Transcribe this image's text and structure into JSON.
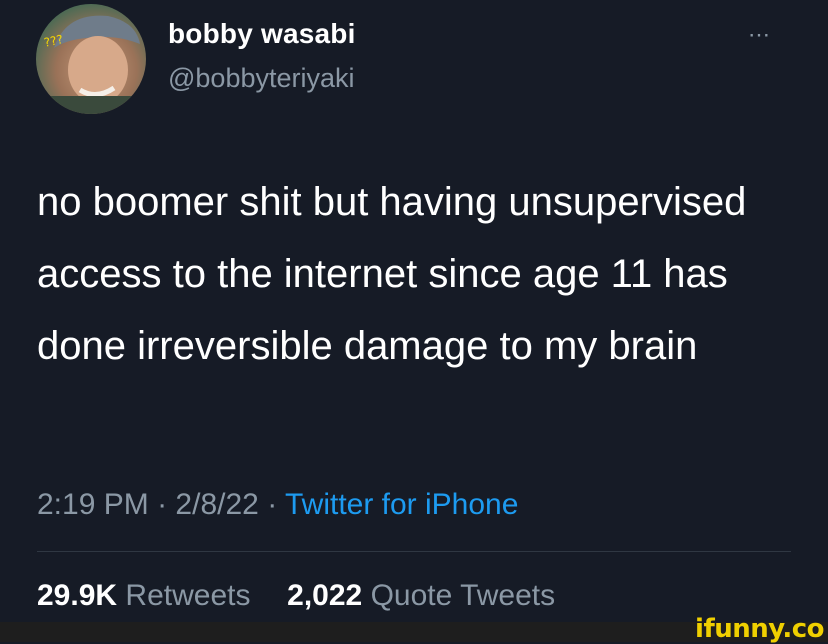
{
  "author": {
    "display_name": "bobby wasabi",
    "handle": "@bobbyteriyaki",
    "avatar_caption": "???"
  },
  "more_icon": "⋯",
  "tweet": {
    "text": "no boomer shit but having unsupervised access to the internet since age 11 has done irreversible damage to my brain",
    "time": "2:19 PM",
    "date": "2/8/22",
    "separator": "·",
    "source": "Twitter for iPhone"
  },
  "stats": {
    "retweets_count": "29.9K",
    "retweets_label": "Retweets",
    "quotes_count": "2,022",
    "quotes_label": "Quote Tweets"
  },
  "watermark": "ifunny.co",
  "colors": {
    "background": "#161b26",
    "text": "#ffffff",
    "muted": "#8b98a5",
    "link": "#1d9bf0",
    "watermark": "#f0d000"
  }
}
